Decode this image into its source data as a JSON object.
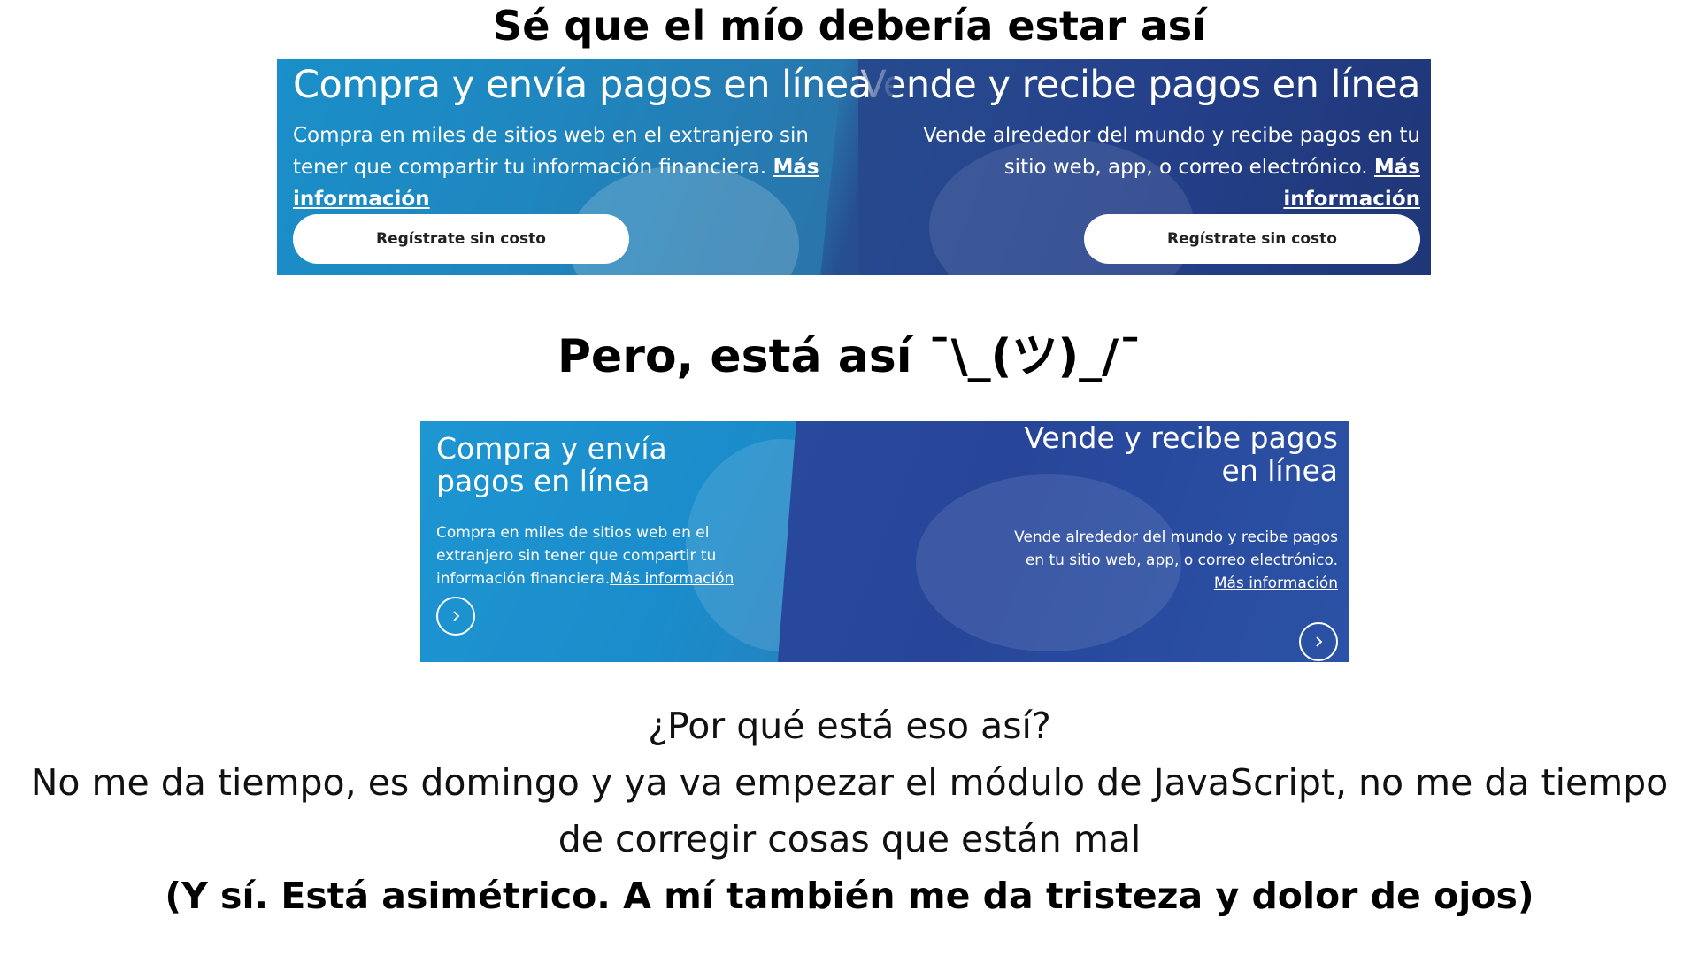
{
  "headings": {
    "expected": "Sé que el mío debería estar así",
    "actual": "Pero, está así ¯\\_(ツ)_/¯"
  },
  "banner_expected": {
    "left": {
      "title": "Compra y envía pagos en línea",
      "text": "Compra en miles de sitios web en el extranjero sin tener que compartir tu información financiera.",
      "link": "Más información",
      "button": "Regístrate sin costo"
    },
    "right": {
      "title": "Vende y recibe pagos en línea",
      "text": "Vende alrededor del mundo y recibe pagos en tu sitio web, app, o correo electrónico.",
      "link": "Más información",
      "button": "Regístrate sin costo"
    }
  },
  "banner_actual": {
    "left": {
      "title": "Compra y envía pagos en línea",
      "text": "Compra en miles de sitios web en el extranjero sin tener que compartir tu información financiera.",
      "link": "Más información"
    },
    "right": {
      "title": "Vende y recibe pagos en línea",
      "text": "Vende alrededor del mundo y recibe pagos en tu sitio web, app, o correo electrónico.",
      "link": "Más información"
    }
  },
  "bottom": {
    "line1": "¿Por qué está eso así?",
    "line2": "No me da tiempo, es domingo y ya va empezar el módulo de JavaScript, no me da tiempo de corregir cosas que están mal",
    "line3": "(Y sí. Está asimétrico. A mí también me da tristeza y dolor de ojos)"
  },
  "colors": {
    "banner_left": "#1b8ccb",
    "banner_right": "#27469a",
    "text_light": "#ffffff"
  }
}
